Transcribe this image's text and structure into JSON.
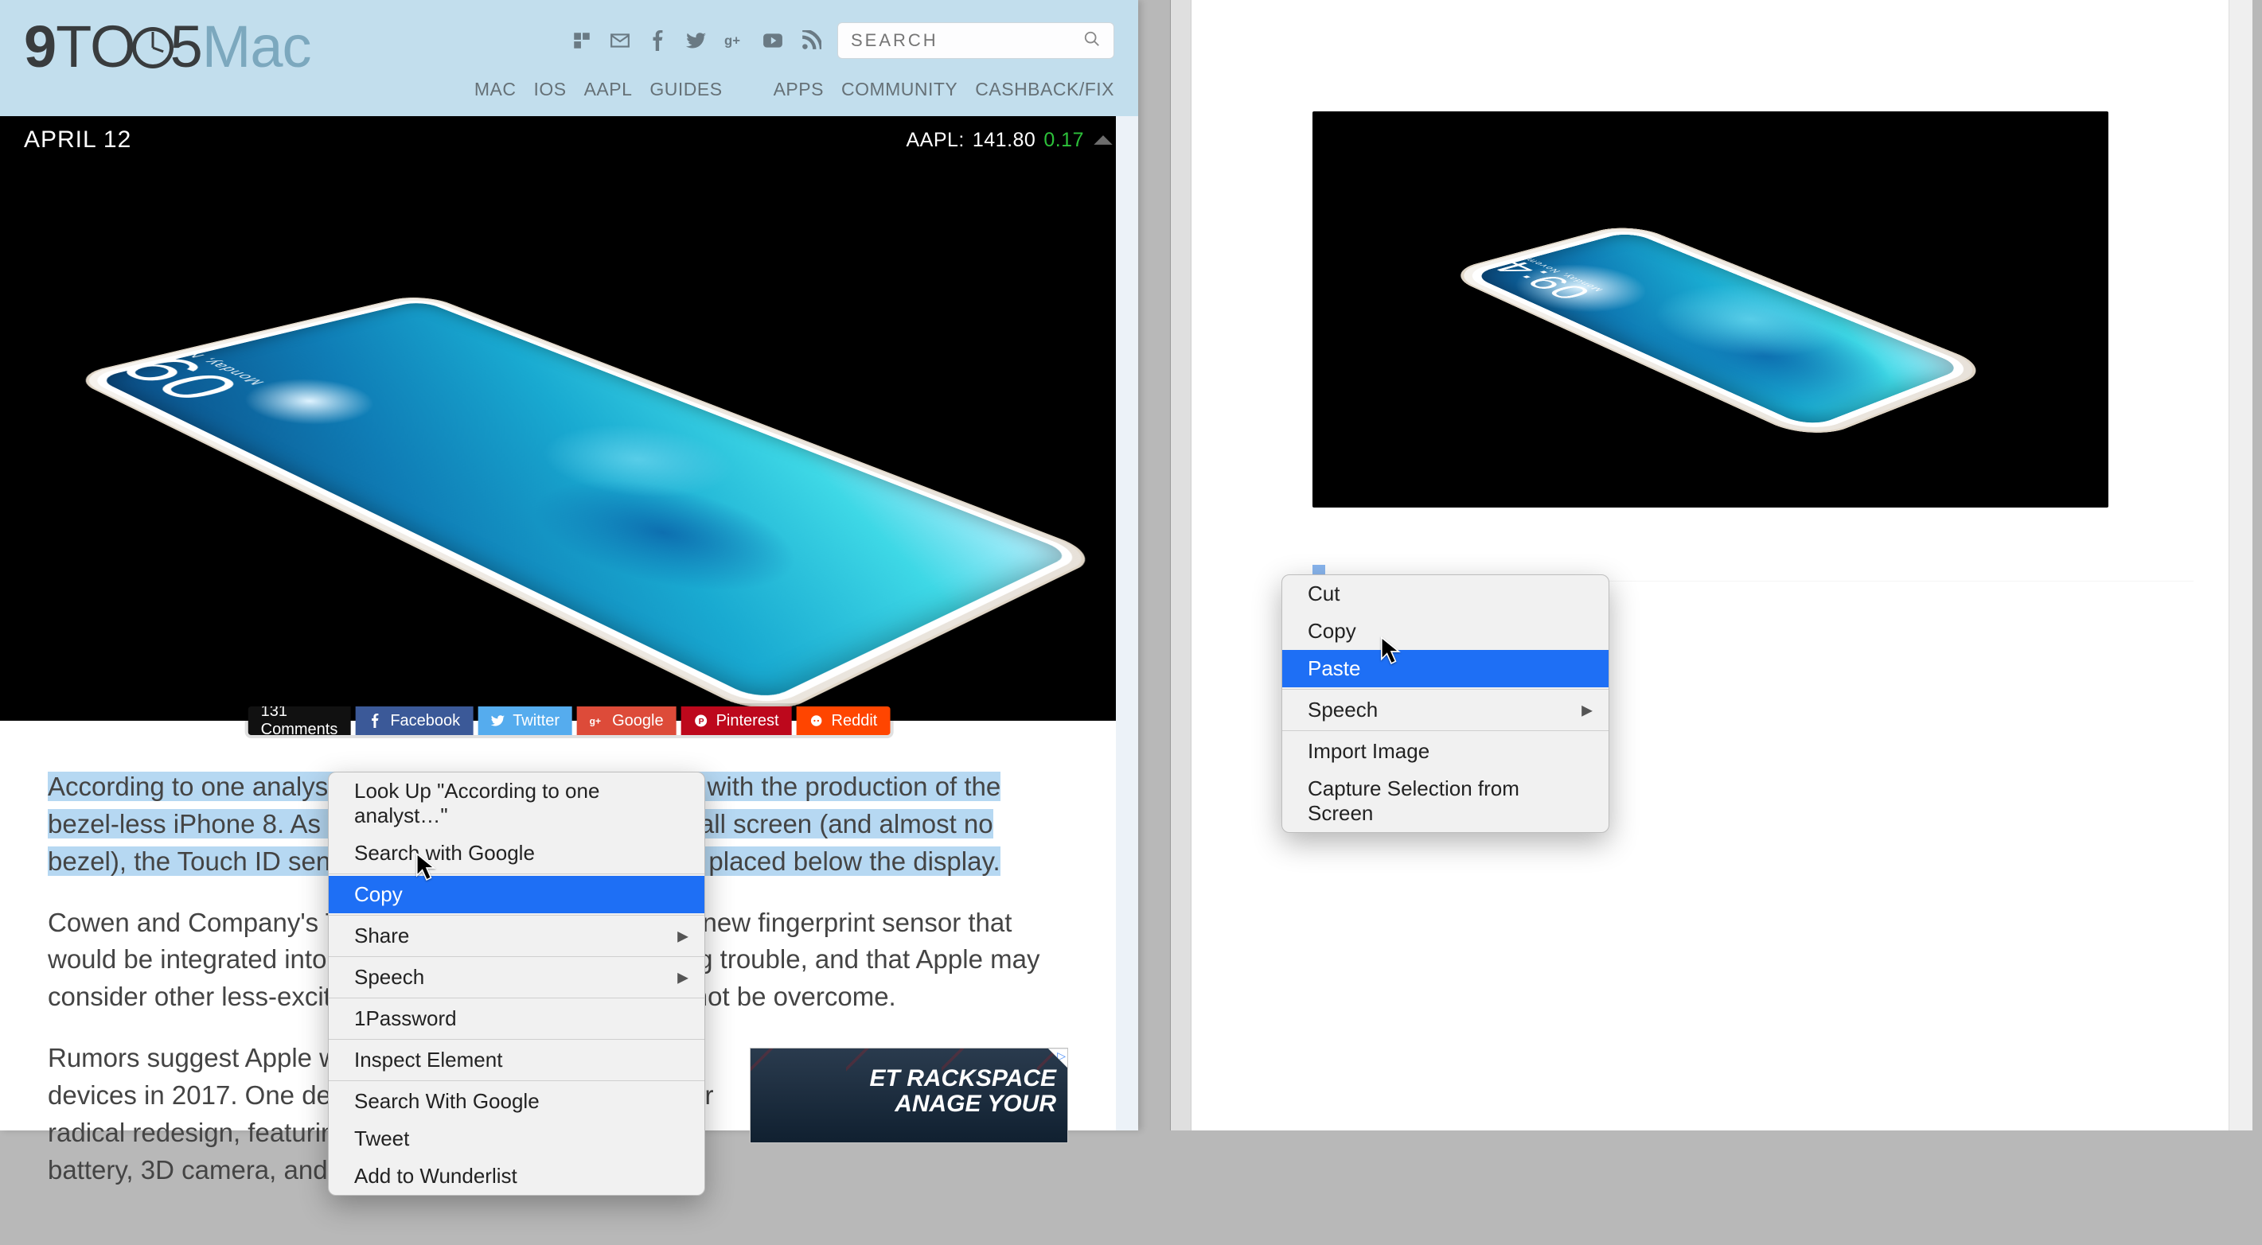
{
  "header": {
    "logo_parts": {
      "nine": "9",
      "to": "TO",
      "five": "5",
      "mac": "Mac"
    },
    "search_placeholder": "SEARCH",
    "nav": {
      "mac": "MAC",
      "ios": "IOS",
      "aapl": "AAPL",
      "guides": "GUIDES",
      "apps": "APPS",
      "community": "COMMUNITY",
      "cashback": "CASHBACK/FIX"
    }
  },
  "datebar": {
    "date": "APRIL 12",
    "ticker": "AAPL:",
    "price": "141.80",
    "change": "0.17"
  },
  "share": {
    "comments": "131 Comments",
    "fb": "Facebook",
    "tw": "Twitter",
    "gp": "Google",
    "pn": "Pinterest",
    "rd": "Reddit"
  },
  "article": {
    "p1_selected": "According to one analyst, Apple is having some difficulty with the production of the bezel-less iPhone 8. As the device's front is supposedly all screen (and almost no bezel), the Touch ID sensor is being re-engineered to be placed below the display.",
    "p2": "Cowen and Company's Timothy Arcuri now believes the new fingerprint sensor that would be integrated into the iPhone 8's display is causing trouble, and that Apple may consider other less-exciting designs if the problems cannot be overcome.",
    "p3": "Rumors suggest Apple will debut three new iPhone devices in 2017. One device is supposed to have a major radical redesign, featuring an all screen display, larger battery, 3D camera, and more."
  },
  "ad": {
    "line1": "ET RACKSPACE",
    "line2": "ANAGE YOUR",
    "badge": "▷"
  },
  "context_left": {
    "lookup": "Look Up \"According to one analyst…\"",
    "search_google": "Search with Google",
    "copy": "Copy",
    "share": "Share",
    "speech": "Speech",
    "onepassword": "1Password",
    "inspect": "Inspect Element",
    "search_with_google": "Search With Google",
    "tweet": "Tweet",
    "wunderlist": "Add to Wunderlist"
  },
  "context_right": {
    "cut": "Cut",
    "copy": "Copy",
    "paste": "Paste",
    "speech": "Speech",
    "import": "Import Image",
    "capture": "Capture Selection from Screen"
  },
  "phone": {
    "time": "09:41",
    "day": "Monday, November 3"
  }
}
